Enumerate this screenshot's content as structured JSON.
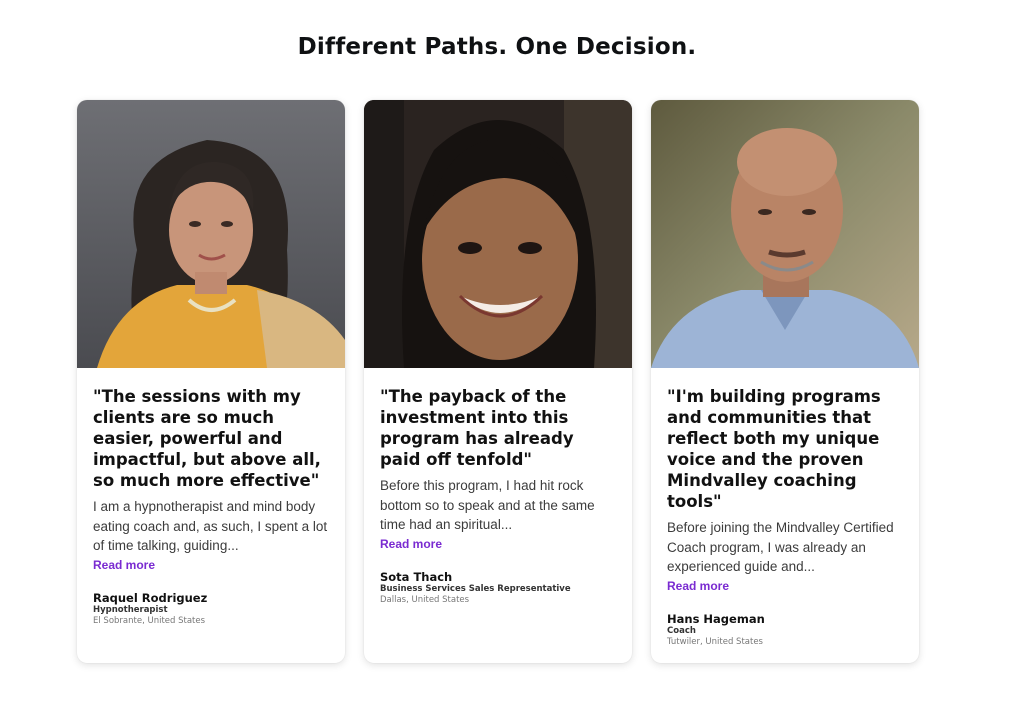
{
  "heading": "Different Paths. One Decision.",
  "cards": [
    {
      "quote": "\"The sessions with my clients are so much easier, powerful and impactful, but above all, so much more effective\"",
      "story": "I am a hypnotherapist and mind body eating coach and, as such, I spent a lot of time talking, guiding...",
      "more": "Read more",
      "name": "Raquel Rodriguez",
      "role": "Hypnotherapist",
      "location": "El Sobrante, United States"
    },
    {
      "quote": "\"The payback of the investment into this program has already paid off tenfold\"",
      "story": "Before this program, I had hit rock bottom so to speak and at the same time had an spiritual...",
      "more": "Read more",
      "name": "Sota Thach",
      "role": "Business Services Sales Representative",
      "location": "Dallas, United States"
    },
    {
      "quote": "\"I'm building programs and communities that reflect both my unique voice and the proven Mindvalley coaching tools\"",
      "story": "Before joining the Mindvalley Certified Coach program, I was already an experienced guide and...",
      "more": "Read more",
      "name": "Hans Hageman",
      "role": "Coach",
      "location": "Tutwiler, United States"
    }
  ],
  "colors": {
    "link": "#7a2bd1",
    "heading": "#0f1113"
  }
}
